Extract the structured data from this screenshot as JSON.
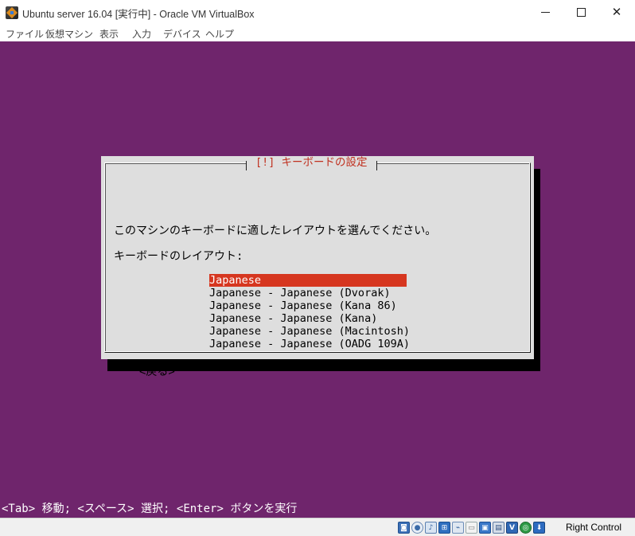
{
  "window": {
    "title": "Ubuntu server 16.04 [実行中] - Oracle VM VirtualBox",
    "minimize_glyph": "",
    "close_glyph": "✕"
  },
  "menubar": {
    "items": [
      "ファイル",
      "仮想マシン",
      "表示",
      "入力",
      "デバイス",
      "ヘルプ"
    ]
  },
  "dialog": {
    "title": "[!] キーボードの設定",
    "prompt": "このマシンのキーボードに適したレイアウトを選んでください。",
    "list_label": "キーボードのレイアウト:",
    "options": [
      "Japanese",
      "Japanese - Japanese (Dvorak)",
      "Japanese - Japanese (Kana 86)",
      "Japanese - Japanese (Kana)",
      "Japanese - Japanese (Macintosh)",
      "Japanese - Japanese (OADG 109A)"
    ],
    "selected_index": 0,
    "back_label": "<戻る>"
  },
  "help_line": "<Tab> 移動; <スペース> 選択; <Enter> ボタンを実行",
  "statusbar": {
    "icons": [
      "hard-disk-icon",
      "optical-drive-icon",
      "audio-icon",
      "network-icon",
      "usb-icon",
      "shared-folders-icon",
      "display-icon",
      "video-capture-icon",
      "cpu-virtualization-icon",
      "mouse-integration-icon",
      "keyboard-capture-icon"
    ],
    "host_key": "Right Control"
  }
}
